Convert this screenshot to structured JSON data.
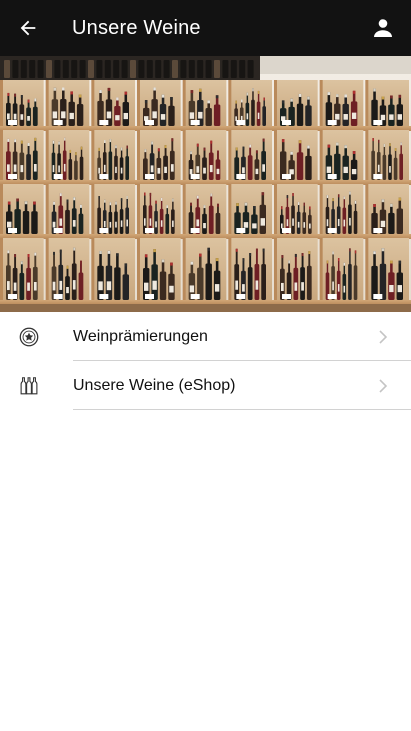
{
  "app_bar": {
    "title": "Unsere Weine",
    "back_icon": "arrow-left-icon",
    "account_icon": "person-icon"
  },
  "hero": {
    "image": "wine-shelves-photo"
  },
  "menu": {
    "items": [
      {
        "label": "Weinprämierungen",
        "icon": "award-medal-icon"
      },
      {
        "label": "Unsere Weine (eShop)",
        "icon": "wine-bottles-icon"
      }
    ]
  },
  "colors": {
    "app_bar_bg": "#121212",
    "divider": "#d2d2d2",
    "chevron": "#c4c4c4"
  }
}
